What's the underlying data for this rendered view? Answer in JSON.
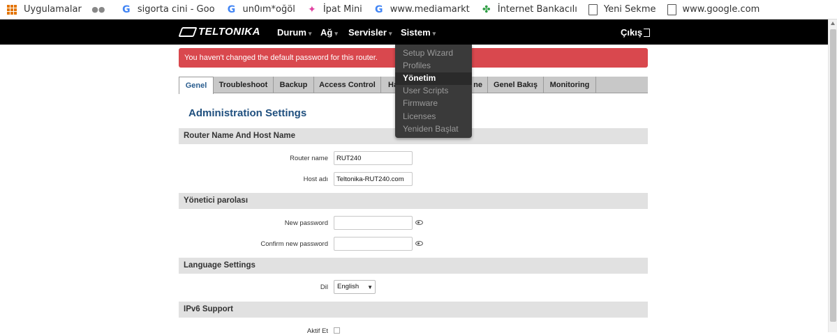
{
  "bookmarks": [
    {
      "icon": "apps-grid-icon",
      "label": "Uygulamalar"
    },
    {
      "icon": "incognito-icon",
      "label": ""
    },
    {
      "icon": "google-g-icon",
      "label": "sigorta cini - Goo"
    },
    {
      "icon": "google-g-icon",
      "label": "un0ım*oğöl"
    },
    {
      "icon": "pinwheel-icon",
      "label": "İpat Mini"
    },
    {
      "icon": "google-g-icon",
      "label": "www.mediamarkt"
    },
    {
      "icon": "clover-icon",
      "label": "İnternet Bankacılı"
    },
    {
      "icon": "page-icon",
      "label": "Yeni Sekme"
    },
    {
      "icon": "page-icon",
      "label": "www.google.com"
    }
  ],
  "nav": {
    "logo": "TELTONIKA",
    "durum": "Durum",
    "ag": "Ağ",
    "servisler": "Servisler",
    "sistem": "Sistem",
    "caret": "▾",
    "logout": "Çıkış"
  },
  "alert": {
    "text": "You haven't changed the default password for this router."
  },
  "tabs": [
    "Genel",
    "Troubleshoot",
    "Backup",
    "Access Control",
    "Ha",
    "ne",
    "Genel Bakış",
    "Monitoring"
  ],
  "page_title": "Administration Settings",
  "sections": {
    "router": {
      "title": "Router Name And Host Name",
      "router_name_label": "Router name",
      "router_name_value": "RUT240",
      "host_label": "Host adı",
      "host_value": "Teltonika-RUT240.com"
    },
    "password": {
      "title": "Yönetici parolası",
      "new_label": "New password",
      "new_value": "",
      "confirm_label": "Confirm new password",
      "confirm_value": ""
    },
    "language": {
      "title": "Language Settings",
      "lang_label": "Dil",
      "lang_value": "English"
    },
    "ipv6": {
      "title": "IPv6 Support",
      "enable_label": "Aktif Et",
      "enabled": false
    }
  },
  "sistem_menu": {
    "items": [
      "Setup Wizard",
      "Profiles",
      "Yönetim",
      "User Scripts",
      "Firmware",
      "Licenses",
      "Yeniden Başlat"
    ],
    "active": "Yönetim"
  },
  "colors": {
    "navbar": "#000000",
    "alert": "#d9484e",
    "title": "#1f4f7e",
    "menu_bg": "#3a3a3a"
  }
}
